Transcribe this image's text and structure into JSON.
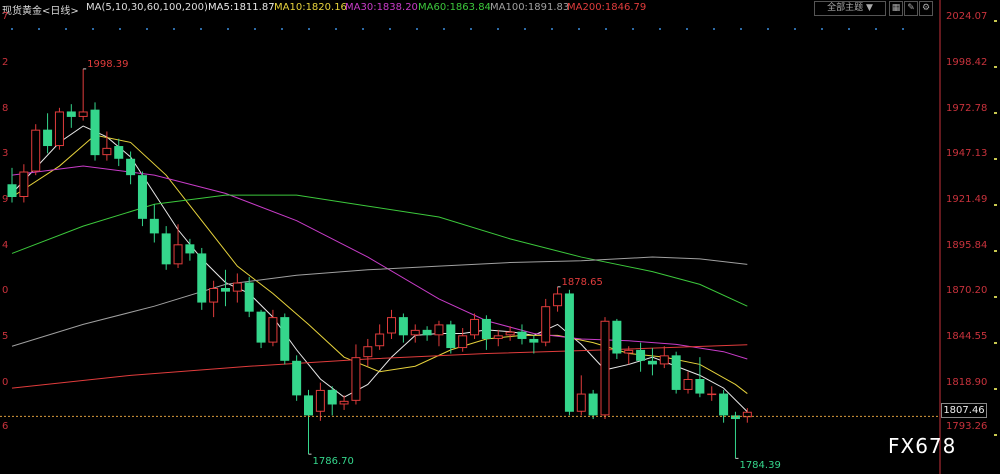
{
  "header": {
    "instrument": "现货黄金<日线>",
    "ma_params": "MA(5,10,30,60,100,200)",
    "ma5": "MA5:1811.87",
    "ma10": "MA10:1820.16",
    "ma30": "MA30:1838.20",
    "ma60": "MA60:1863.84",
    "ma100": "MA100:1891.83",
    "ma200": "MA200:1846.79",
    "theme_select": "全部主题 ▼"
  },
  "colors": {
    "bull": "#e03c3c",
    "bear": "#35d68c",
    "ma5": "#e8e8e8",
    "ma10": "#e6d23c",
    "ma30": "#c83cc8",
    "ma60": "#3cc83c",
    "ma100": "#a0a0a0",
    "ma200": "#e03c3c",
    "axis_text": "#c8323c"
  },
  "chart_data": {
    "type": "candlestick",
    "y_ticks": [
      "2024.07",
      "1998.42",
      "1972.78",
      "1947.13",
      "1921.49",
      "1895.84",
      "1870.20",
      "1844.55",
      "1818.90",
      "1793.26"
    ],
    "ylim": [
      1778,
      2028
    ],
    "last_price": "1807.46",
    "annotations": [
      {
        "label": "1998.39",
        "value": 1998.39,
        "bar": 6
      },
      {
        "label": "1786.70",
        "value": 1786.7,
        "bar": 25
      },
      {
        "label": "1878.65",
        "value": 1878.65,
        "bar": 46
      },
      {
        "label": "1784.39",
        "value": 1784.39,
        "bar": 61
      }
    ],
    "candles": [
      [
        1935,
        1928,
        1944,
        1925
      ],
      [
        1928,
        1942,
        1946,
        1925
      ],
      [
        1942,
        1965,
        1968,
        1940
      ],
      [
        1965,
        1956,
        1974,
        1952
      ],
      [
        1956,
        1975,
        1977,
        1954
      ],
      [
        1975,
        1972,
        1979,
        1966
      ],
      [
        1972,
        1975,
        1998.39,
        1970
      ],
      [
        1976,
        1951,
        1980,
        1948
      ],
      [
        1951,
        1955,
        1964,
        1948
      ],
      [
        1956,
        1949,
        1960,
        1945
      ],
      [
        1949,
        1940,
        1953,
        1935
      ],
      [
        1940,
        1916,
        1942,
        1912
      ],
      [
        1916,
        1908,
        1924,
        1903
      ],
      [
        1908,
        1891,
        1912,
        1888
      ],
      [
        1891,
        1902,
        1913,
        1889
      ],
      [
        1902,
        1897,
        1905,
        1893
      ],
      [
        1897,
        1870,
        1900,
        1866
      ],
      [
        1870,
        1878,
        1882,
        1862
      ],
      [
        1878,
        1876,
        1888,
        1868
      ],
      [
        1876,
        1881,
        1886,
        1870
      ],
      [
        1881,
        1865,
        1884,
        1862
      ],
      [
        1865,
        1848,
        1866,
        1845
      ],
      [
        1848,
        1862,
        1866,
        1846
      ],
      [
        1862,
        1838,
        1864,
        1836
      ],
      [
        1838,
        1819,
        1841,
        1816
      ],
      [
        1819,
        1808,
        1822,
        1786.7
      ],
      [
        1810,
        1822,
        1826,
        1805
      ],
      [
        1822,
        1814,
        1824,
        1808
      ],
      [
        1814,
        1816,
        1819,
        1811
      ],
      [
        1816,
        1840,
        1847,
        1814
      ],
      [
        1840,
        1846,
        1850,
        1835
      ],
      [
        1846,
        1853,
        1858,
        1844
      ],
      [
        1853,
        1862,
        1866,
        1850
      ],
      [
        1862,
        1852,
        1864,
        1848
      ],
      [
        1852,
        1855,
        1858,
        1848
      ],
      [
        1855,
        1852,
        1857,
        1849
      ],
      [
        1852,
        1858,
        1860,
        1846
      ],
      [
        1858,
        1845,
        1860,
        1842
      ],
      [
        1845,
        1852,
        1856,
        1843
      ],
      [
        1852,
        1861,
        1864,
        1850
      ],
      [
        1861,
        1850,
        1863,
        1844
      ],
      [
        1850,
        1852,
        1855,
        1846
      ],
      [
        1852,
        1854,
        1857,
        1849
      ],
      [
        1854,
        1850,
        1858,
        1847
      ],
      [
        1850,
        1848,
        1852,
        1842
      ],
      [
        1848,
        1868,
        1872,
        1846
      ],
      [
        1868,
        1875,
        1878.65,
        1865
      ],
      [
        1875,
        1810,
        1877,
        1808
      ],
      [
        1810,
        1820,
        1830,
        1808
      ],
      [
        1820,
        1808,
        1822,
        1806
      ],
      [
        1808,
        1860,
        1862,
        1806
      ],
      [
        1860,
        1842,
        1861,
        1839
      ],
      [
        1842,
        1844,
        1846,
        1836
      ],
      [
        1844,
        1838,
        1848,
        1832
      ],
      [
        1838,
        1836,
        1845,
        1830
      ],
      [
        1836,
        1841,
        1846,
        1834
      ],
      [
        1841,
        1822,
        1843,
        1820
      ],
      [
        1822,
        1828,
        1832,
        1820
      ],
      [
        1828,
        1820,
        1840,
        1818
      ],
      [
        1820,
        1820,
        1824,
        1816
      ],
      [
        1820,
        1808,
        1822,
        1804
      ],
      [
        1808,
        1806,
        1810,
        1784.39
      ],
      [
        1807,
        1810,
        1812,
        1804
      ]
    ],
    "ma_series": [
      {
        "key": "ma5",
        "points": [
          [
            0,
            1930
          ],
          [
            2,
            1944
          ],
          [
            4,
            1958
          ],
          [
            6,
            1967
          ],
          [
            8,
            1961
          ],
          [
            10,
            1950
          ],
          [
            12,
            1930
          ],
          [
            14,
            1910
          ],
          [
            16,
            1894
          ],
          [
            18,
            1881
          ],
          [
            20,
            1875
          ],
          [
            22,
            1862
          ],
          [
            24,
            1844
          ],
          [
            26,
            1828
          ],
          [
            28,
            1818
          ],
          [
            30,
            1825
          ],
          [
            32,
            1840
          ],
          [
            34,
            1852
          ],
          [
            36,
            1853
          ],
          [
            38,
            1853
          ],
          [
            40,
            1855
          ],
          [
            42,
            1854
          ],
          [
            44,
            1852
          ],
          [
            46,
            1858
          ],
          [
            48,
            1847
          ],
          [
            50,
            1833
          ],
          [
            52,
            1836
          ],
          [
            54,
            1840
          ],
          [
            56,
            1835
          ],
          [
            58,
            1830
          ],
          [
            60,
            1823
          ],
          [
            62,
            1810
          ]
        ]
      },
      {
        "key": "ma10",
        "points": [
          [
            0,
            1928
          ],
          [
            4,
            1945
          ],
          [
            7,
            1962
          ],
          [
            10,
            1958
          ],
          [
            13,
            1940
          ],
          [
            16,
            1915
          ],
          [
            19,
            1890
          ],
          [
            22,
            1875
          ],
          [
            25,
            1858
          ],
          [
            28,
            1840
          ],
          [
            31,
            1832
          ],
          [
            34,
            1835
          ],
          [
            37,
            1844
          ],
          [
            40,
            1850
          ],
          [
            43,
            1852
          ],
          [
            46,
            1852
          ],
          [
            49,
            1848
          ],
          [
            52,
            1842
          ],
          [
            55,
            1840
          ],
          [
            58,
            1836
          ],
          [
            61,
            1825
          ],
          [
            62,
            1820
          ]
        ]
      },
      {
        "key": "ma30",
        "points": [
          [
            0,
            1940
          ],
          [
            6,
            1945
          ],
          [
            12,
            1940
          ],
          [
            18,
            1930
          ],
          [
            24,
            1915
          ],
          [
            30,
            1895
          ],
          [
            36,
            1872
          ],
          [
            40,
            1860
          ],
          [
            44,
            1853
          ],
          [
            48,
            1850
          ],
          [
            52,
            1849
          ],
          [
            56,
            1847
          ],
          [
            60,
            1843
          ],
          [
            62,
            1839
          ]
        ]
      },
      {
        "key": "ma60",
        "points": [
          [
            0,
            1897
          ],
          [
            6,
            1912
          ],
          [
            12,
            1924
          ],
          [
            18,
            1929
          ],
          [
            24,
            1929
          ],
          [
            30,
            1923
          ],
          [
            36,
            1917
          ],
          [
            42,
            1905
          ],
          [
            48,
            1895
          ],
          [
            54,
            1887
          ],
          [
            58,
            1880
          ],
          [
            62,
            1868
          ]
        ]
      },
      {
        "key": "ma100",
        "points": [
          [
            0,
            1846
          ],
          [
            6,
            1858
          ],
          [
            12,
            1868
          ],
          [
            18,
            1880
          ],
          [
            24,
            1885
          ],
          [
            30,
            1888
          ],
          [
            36,
            1890
          ],
          [
            42,
            1892
          ],
          [
            48,
            1893
          ],
          [
            54,
            1895
          ],
          [
            58,
            1894
          ],
          [
            62,
            1891
          ]
        ]
      },
      {
        "key": "ma200",
        "points": [
          [
            0,
            1823
          ],
          [
            10,
            1830
          ],
          [
            20,
            1835
          ],
          [
            30,
            1839
          ],
          [
            40,
            1842
          ],
          [
            50,
            1844
          ],
          [
            62,
            1846.8
          ]
        ]
      }
    ]
  },
  "left_ticks": [
    "7",
    "2",
    "8",
    "3",
    "9",
    "4",
    "0",
    "5",
    "0",
    "6"
  ],
  "watermark": "FX678"
}
